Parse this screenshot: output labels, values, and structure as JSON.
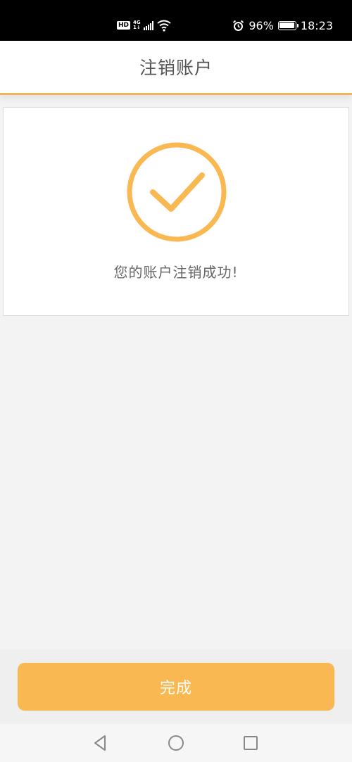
{
  "status_bar": {
    "hd_label": "HD",
    "network_label_top": "4G",
    "network_label_bottom": "1↓",
    "battery_percent": "96%",
    "battery_level": 0.96,
    "time": "18:23"
  },
  "header": {
    "title": "注销账户"
  },
  "result": {
    "message": "您的账户注销成功!",
    "icon": "checkmark-circle-icon"
  },
  "footer": {
    "done_label": "完成"
  },
  "colors": {
    "accent": "#f9b852",
    "header_underline": "#f2b45a",
    "background": "#f3f3f3"
  }
}
